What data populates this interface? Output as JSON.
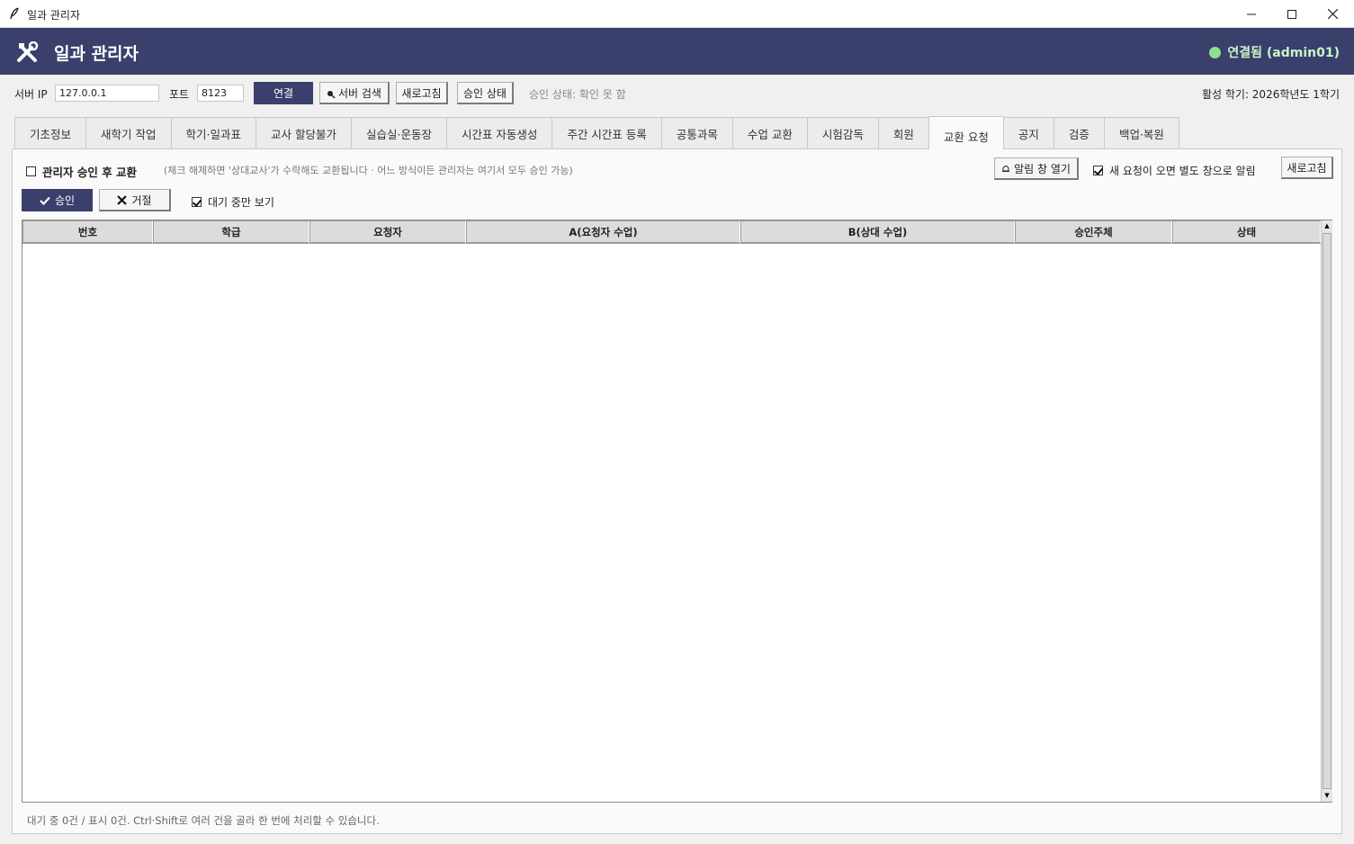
{
  "window": {
    "title": "일과 관리자"
  },
  "header": {
    "title": "일과 관리자",
    "connection": "연결됨 (admin01)"
  },
  "toolbar": {
    "server_ip_label": "서버 IP",
    "server_ip_value": "127.0.0.1",
    "port_label": "포트",
    "port_value": "8123",
    "connect": "연결",
    "server_search": "서버 검색",
    "refresh": "새로고침",
    "approval_status": "승인 상태",
    "approval_state_text": "승인 상태: 확인 못 함",
    "active_term": "활성 학기: 2026학년도 1학기"
  },
  "tabs": [
    {
      "label": "기초정보"
    },
    {
      "label": "새학기 작업"
    },
    {
      "label": "학기·일과표"
    },
    {
      "label": "교사 할당불가"
    },
    {
      "label": "실습실·운동장"
    },
    {
      "label": "시간표 자동생성"
    },
    {
      "label": "주간 시간표 등록"
    },
    {
      "label": "공통과목"
    },
    {
      "label": "수업 교환"
    },
    {
      "label": "시험감독"
    },
    {
      "label": "회원"
    },
    {
      "label": "교환 요청"
    },
    {
      "label": "공지"
    },
    {
      "label": "검증"
    },
    {
      "label": "백업·복원"
    }
  ],
  "exchange": {
    "admin_approval_label": "관리자 승인 후 교환",
    "admin_approval_checked": false,
    "hint": "(체크 해제하면 '상대교사'가 수락해도 교환됩니다 · 어느 방식이든 관리자는 여기서 모두 승인 가능)",
    "open_alert_window": "알림 창 열기",
    "notify_new_label": "새 요청이 오면 별도 창으로 알림",
    "notify_new_checked": true,
    "refresh": "새로고침",
    "approve": "승인",
    "reject": "거절",
    "pending_only_label": "대기 중만 보기",
    "pending_only_checked": true,
    "columns": [
      "번호",
      "학급",
      "요청자",
      "A(요청자 수업)",
      "B(상대 수업)",
      "승인주체",
      "상태"
    ],
    "rows": [],
    "status": "대기 중 0건 / 표시 0건. Ctrl·Shift로 여러 건을 골라 한 번에 처리할 수 있습니다."
  },
  "colors": {
    "header_bg": "#3a3f6b",
    "connected": "#8fe08f"
  }
}
